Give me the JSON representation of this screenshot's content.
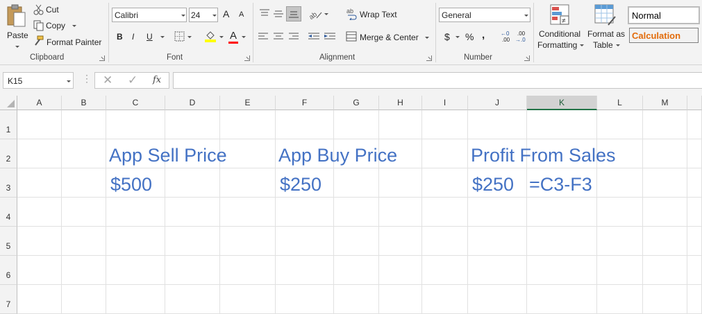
{
  "clipboard": {
    "paste": "Paste",
    "cut": "Cut",
    "copy": "Copy",
    "format_painter": "Format Painter",
    "group_label": "Clipboard"
  },
  "font": {
    "name": "Calibri",
    "size": "24",
    "bold": "B",
    "italic": "I",
    "underline": "U",
    "grow": "A",
    "shrink": "A",
    "color_letter": "A",
    "group_label": "Font"
  },
  "alignment": {
    "wrap_text": "Wrap Text",
    "merge_center": "Merge & Center",
    "group_label": "Alignment"
  },
  "number": {
    "format": "General",
    "currency": "$",
    "percent": "%",
    "comma": ",",
    "inc_decimal_top": "←0",
    "inc_decimal_bottom": ".00",
    "dec_decimal_top": ".00",
    "dec_decimal_bottom": "→.0",
    "group_label": "Number"
  },
  "styles": {
    "conditional_line1": "Conditional",
    "conditional_line2": "Formatting",
    "table_line1": "Format as",
    "table_line2": "Table",
    "normal": "Normal",
    "calculation": "Calculation",
    "calc_color": "#e26b0a"
  },
  "formula_bar": {
    "name_box": "K15",
    "fx": "fx",
    "formula": ""
  },
  "sheet": {
    "columns": [
      "A",
      "B",
      "C",
      "D",
      "E",
      "F",
      "G",
      "H",
      "I",
      "J",
      "K",
      "L",
      "M"
    ],
    "selected_column": "K",
    "rows": [
      "1",
      "2",
      "3",
      "4",
      "5",
      "6",
      "7"
    ],
    "cells": {
      "C2": "App Sell Price",
      "F2": "App Buy Price",
      "J2": "Profit From Sales",
      "C3": "$500",
      "F3": "$250",
      "J3": "$250",
      "K3": "=C3-F3"
    },
    "text_color": "#4472c4"
  }
}
